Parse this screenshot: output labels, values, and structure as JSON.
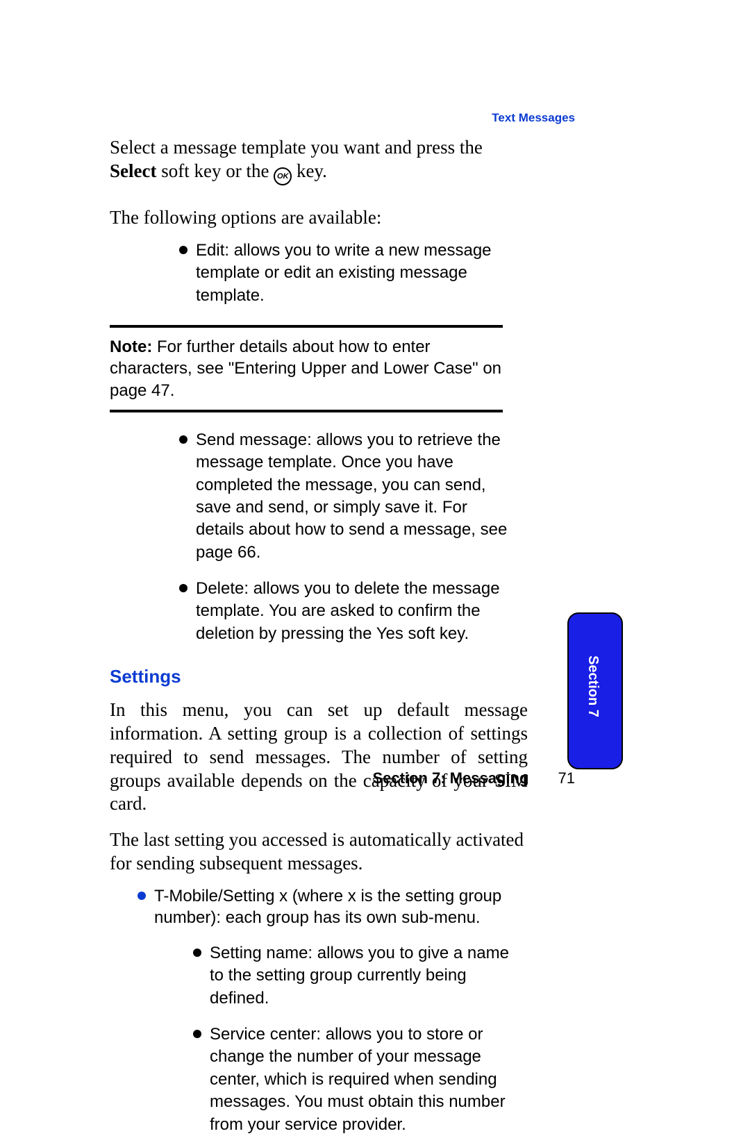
{
  "header": {
    "tag": "Text Messages"
  },
  "intro": {
    "line1_pre": "Select a message template you want and press the ",
    "select_bold": "Select",
    "line1_post_a": " soft key or the ",
    "ok_glyph": "OK",
    "line1_post_b": " key.",
    "line2": "The following options are available:"
  },
  "bullets_top": [
    "Edit: allows you to write a new message template or edit an existing message template."
  ],
  "note": {
    "label": "Note:",
    "text": " For further details about how to enter characters, see \"Entering Upper and Lower Case\" on page 47."
  },
  "bullets_mid": [
    "Send message: allows you to retrieve the message template. Once you have completed the message, you can send, save and send, or simply save it. For details about how to send a message, see page 66.",
    "Delete: allows you to delete the message template. You are asked to confirm the deletion by pressing the Yes soft key."
  ],
  "settings": {
    "heading": "Settings",
    "p1": "In this menu, you can set up default message information. A setting group is a collection of settings required to send messages. The number of setting groups available depends on the capacity of your SIM card.",
    "p2": "The last setting you accessed is automatically activated for sending subsequent messages.",
    "blue_bullet": "T-Mobile/Setting x (where x is the setting group number): each group has its own sub-menu.",
    "sub_bullets": [
      "Setting name: allows you to give a name to the setting group currently being defined.",
      "Service center: allows you to store or change the number of your message center, which is required when sending messages. You must obtain this number from your service provider."
    ]
  },
  "footer": {
    "section": "Section 7: Messaging",
    "page": "71"
  },
  "side_tab": {
    "label": "Section 7"
  }
}
